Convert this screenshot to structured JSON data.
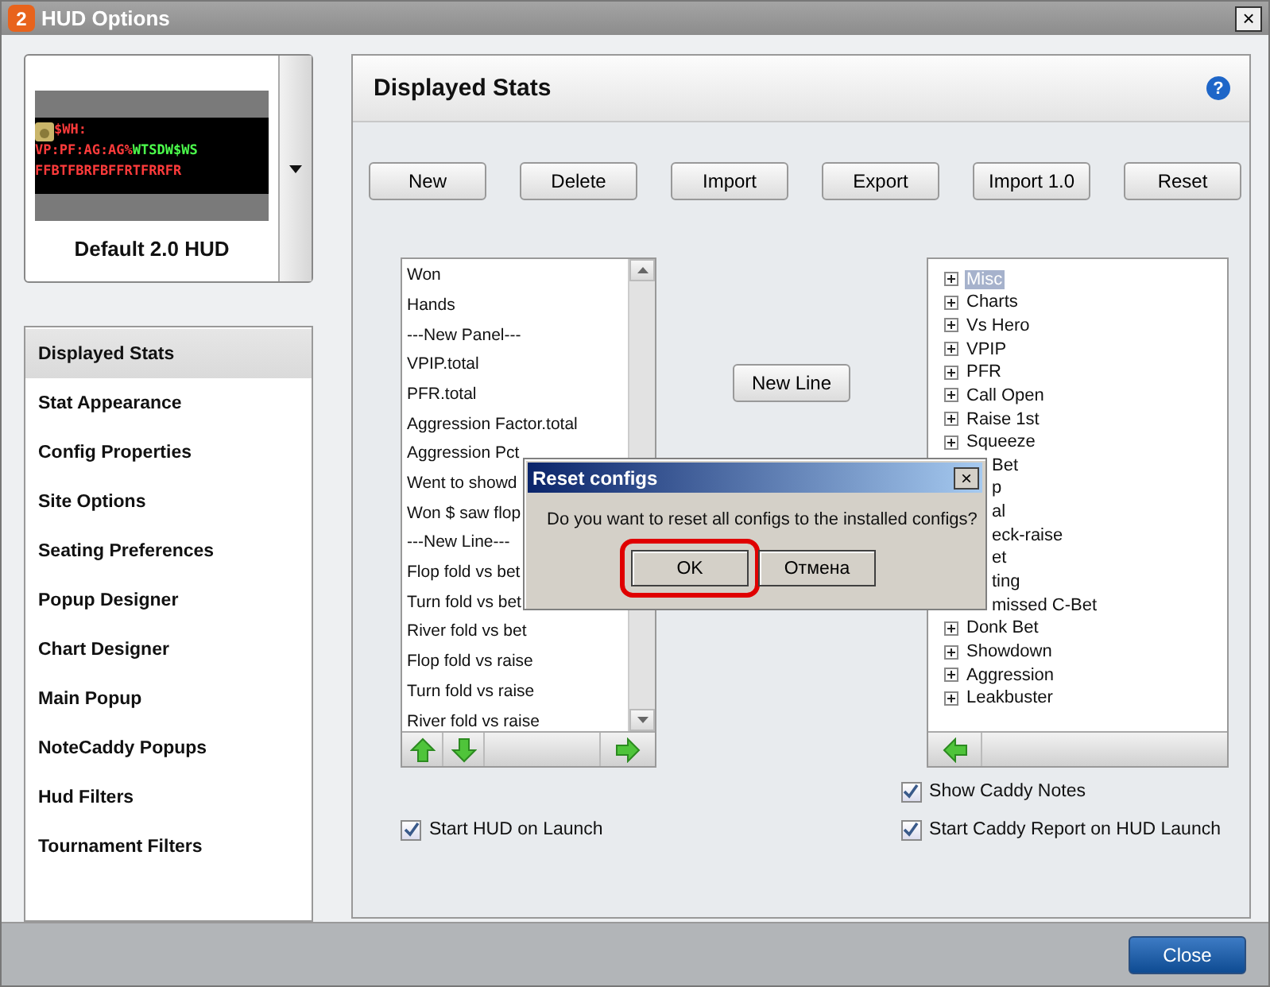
{
  "window": {
    "title": "HUD Options",
    "badge": "2",
    "close": "×"
  },
  "hud": {
    "name": "Default 2.0 HUD",
    "preview": [
      [
        {
          "text": "$WH:",
          "color": "#ff3b3b"
        }
      ],
      [
        {
          "text": "VP:PF:AG:AG%",
          "color": "#ff3b3b"
        },
        {
          "text": "WTSDW$WS",
          "color": "#4cff4c"
        }
      ],
      [
        {
          "text": "FFBTFBRFBFFRTFRRFR",
          "color": "#ff3b3b"
        }
      ]
    ]
  },
  "nav": [
    {
      "label": "Displayed Stats",
      "selected": true
    },
    {
      "label": "Stat Appearance",
      "selected": false
    },
    {
      "label": "Config Properties",
      "selected": false
    },
    {
      "label": "Site Options",
      "selected": false
    },
    {
      "label": "Seating Preferences",
      "selected": false
    },
    {
      "label": "Popup Designer",
      "selected": false
    },
    {
      "label": "Chart Designer",
      "selected": false
    },
    {
      "label": "Main Popup",
      "selected": false
    },
    {
      "label": "NoteCaddy Popups",
      "selected": false
    },
    {
      "label": "Hud Filters",
      "selected": false
    },
    {
      "label": "Tournament Filters",
      "selected": false
    }
  ],
  "panel": {
    "title": "Displayed Stats",
    "help": "?"
  },
  "toolbar": [
    "New",
    "Delete",
    "Import",
    "Export",
    "Import 1.0",
    "Reset"
  ],
  "stat_list": [
    "Won",
    "Hands",
    "---New Panel---",
    "VPIP.total",
    "PFR.total",
    "Aggression Factor.total",
    "Aggression Pct",
    "Went to showd",
    "Won $ saw flop",
    "---New Line---",
    "Flop fold vs bet",
    "Turn fold vs bet",
    "River fold vs bet",
    "Flop fold vs raise",
    "Turn fold vs raise",
    "River fold vs raise"
  ],
  "new_line_button": "New Line",
  "stat_tree": [
    {
      "kind": "node",
      "label": "Misc",
      "selected": true
    },
    {
      "kind": "node",
      "label": "Charts",
      "selected": false
    },
    {
      "kind": "node",
      "label": "Vs Hero",
      "selected": false
    },
    {
      "kind": "node",
      "label": "VPIP",
      "selected": false
    },
    {
      "kind": "node",
      "label": "PFR",
      "selected": false
    },
    {
      "kind": "node",
      "label": "Call Open",
      "selected": false
    },
    {
      "kind": "node",
      "label": "Raise 1st",
      "selected": false
    },
    {
      "kind": "node",
      "label": "Squeeze",
      "selected": false
    },
    {
      "kind": "clipped",
      "label": "Bet",
      "selected": false
    },
    {
      "kind": "clipped",
      "label": "p",
      "selected": false
    },
    {
      "kind": "clipped",
      "label": "al",
      "selected": false
    },
    {
      "kind": "clipped",
      "label": "eck-raise",
      "selected": false
    },
    {
      "kind": "clipped",
      "label": "et",
      "selected": false
    },
    {
      "kind": "clipped",
      "label": "ting",
      "selected": false
    },
    {
      "kind": "clipped",
      "label": "missed C-Bet",
      "selected": false
    },
    {
      "kind": "node",
      "label": "Donk Bet",
      "selected": false
    },
    {
      "kind": "node",
      "label": "Showdown",
      "selected": false
    },
    {
      "kind": "node",
      "label": "Aggression",
      "selected": false
    },
    {
      "kind": "node",
      "label": "Leakbuster",
      "selected": false
    }
  ],
  "options_left": [
    {
      "label": "Start HUD on Launch",
      "checked": true
    }
  ],
  "options_right": [
    {
      "label": "Show Caddy Notes",
      "checked": true
    },
    {
      "label": "Start Caddy Report on HUD Launch",
      "checked": true
    }
  ],
  "close_button": "Close",
  "dialog": {
    "title": "Reset configs",
    "close": "×",
    "message": "Do you want to reset all configs to the installed configs?",
    "buttons": [
      {
        "label": "OK",
        "highlighted": true
      },
      {
        "label": "Отмена",
        "highlighted": false
      }
    ]
  }
}
